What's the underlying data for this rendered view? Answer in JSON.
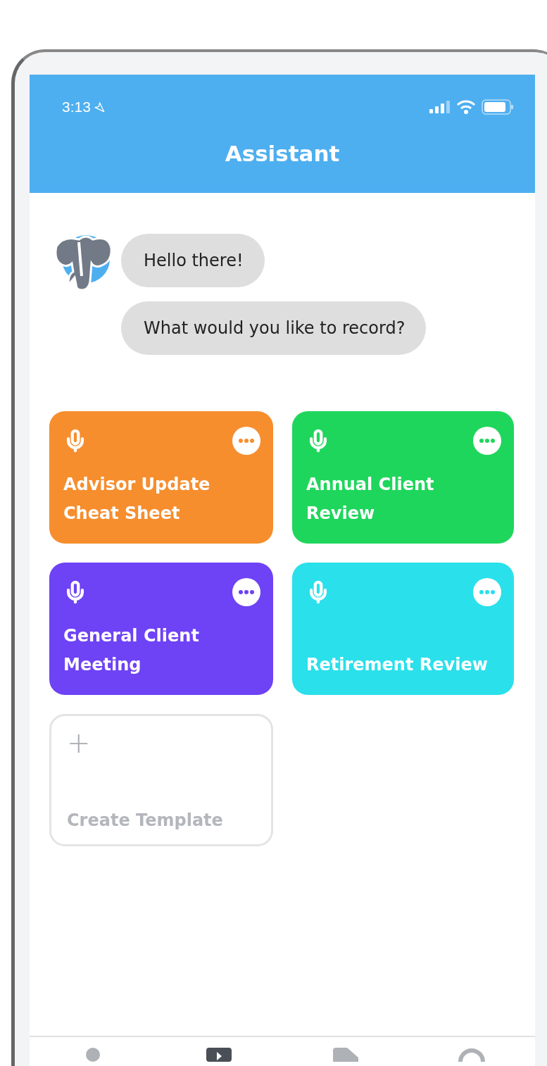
{
  "status_bar": {
    "time": "3:13"
  },
  "header": {
    "title": "Assistant"
  },
  "messages": [
    {
      "text": "Hello there!"
    },
    {
      "text": "What would you like to record?"
    }
  ],
  "templates": [
    {
      "title": "Advisor Update Cheat Sheet",
      "color": "#f68e2e"
    },
    {
      "title": "Annual Client Review",
      "color": "#1fd65c"
    },
    {
      "title": "General Client Meeting",
      "color": "#6e42f5"
    },
    {
      "title": "Retirement Review",
      "color": "#2ae0eb"
    }
  ],
  "create_template": {
    "icon": "+",
    "label": "Create Template"
  },
  "tab_bar": [
    {
      "selected": false
    },
    {
      "selected": true
    },
    {
      "selected": false
    },
    {
      "selected": false
    }
  ]
}
